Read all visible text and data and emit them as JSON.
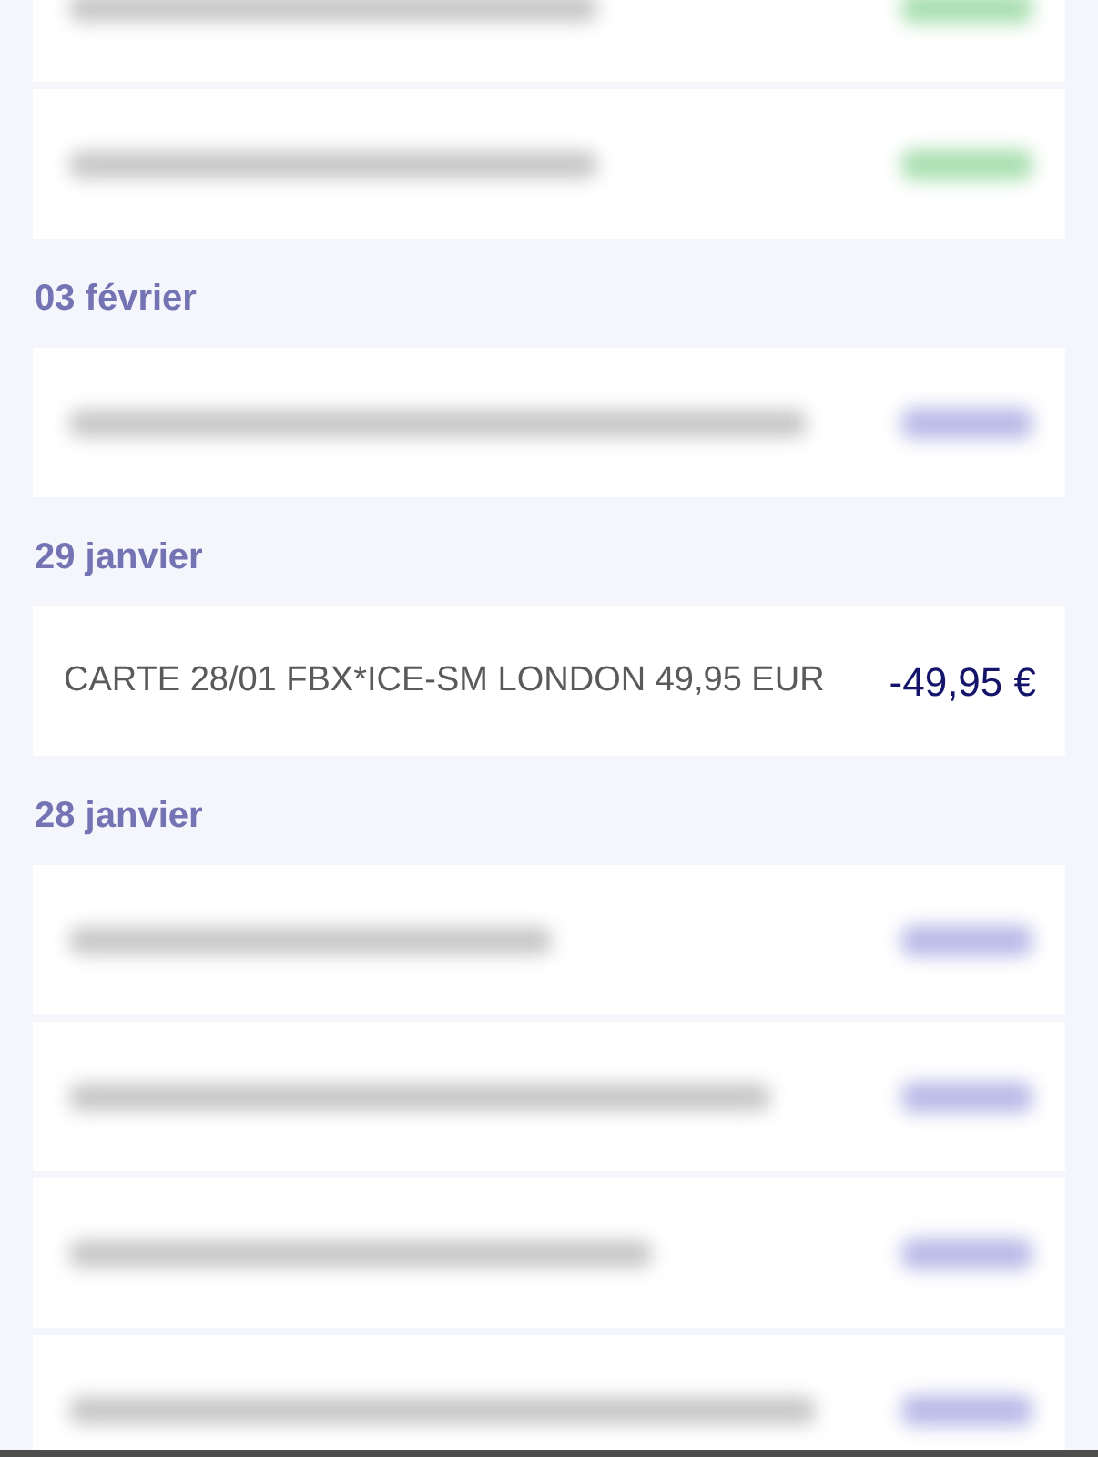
{
  "groups": [
    {
      "rows": [
        {
          "kind": "blurred",
          "color": "#a9dfb0"
        },
        {
          "kind": "blurred",
          "color": "#a9dfb0"
        }
      ]
    },
    {
      "date": "03 février",
      "rows": [
        {
          "kind": "blurred",
          "color": "#b9b9e8"
        }
      ]
    },
    {
      "date": "29 janvier",
      "rows": [
        {
          "kind": "entry",
          "label": "CARTE 28/01 FBX*ICE-SM LONDON 49,95 EUR",
          "amount": "-49,95 €"
        }
      ]
    },
    {
      "date": "28 janvier",
      "rows": [
        {
          "kind": "blurred",
          "color": "#b9b9e8"
        },
        {
          "kind": "blurred",
          "color": "#b9b9e8"
        },
        {
          "kind": "blurred",
          "color": "#b9b9e8"
        },
        {
          "kind": "blurred",
          "color": "#b9b9e8"
        }
      ]
    }
  ]
}
